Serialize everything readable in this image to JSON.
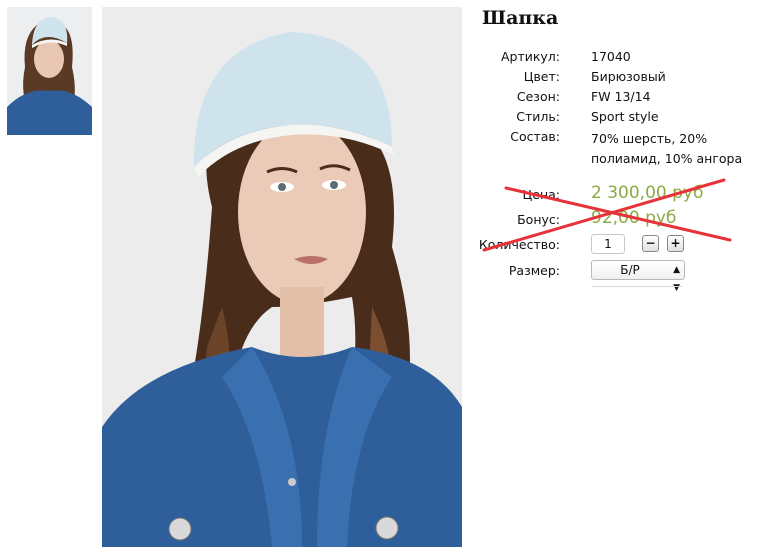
{
  "product": {
    "title": "Шапка",
    "attributes": [
      {
        "label": "Артикул:",
        "value": "17040"
      },
      {
        "label": "Цвет:",
        "value": "Бирюзовый"
      },
      {
        "label": "Сезон:",
        "value": "FW 13/14"
      },
      {
        "label": "Стиль:",
        "value": "Sport style"
      },
      {
        "label": "Состав:",
        "value": "70% шерсть, 20% полиамид, 10% ангора"
      }
    ],
    "price": {
      "label": "Цена:",
      "value": "2 300,00 руб"
    },
    "bonus": {
      "label": "Бонус:",
      "value": "92,00 руб"
    },
    "quantity": {
      "label": "Количество:",
      "value": "1",
      "minus": "−",
      "plus": "+"
    },
    "size": {
      "label": "Размер:",
      "selected": "Б/Р"
    }
  },
  "colors": {
    "price_green": "#8caa43",
    "cross_red": "#e8323a",
    "hat": "#cfe3ec",
    "denim": "#2f5f9a"
  }
}
